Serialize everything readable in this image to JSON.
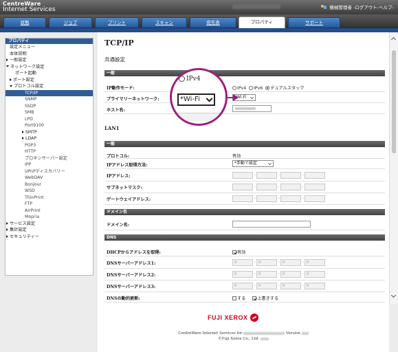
{
  "header": {
    "brand_line1": "CentreWare",
    "brand_line2": "Internet Services",
    "user_menu": "機械管理者 -ログアウト-ヘルプ-"
  },
  "tabs": [
    {
      "label": "状態"
    },
    {
      "label": "ジョブ"
    },
    {
      "label": "プリント"
    },
    {
      "label": "スキャン"
    },
    {
      "label": "宛先表"
    },
    {
      "label": "プロパティ"
    },
    {
      "label": "サポート"
    }
  ],
  "sidebar": {
    "heading": "プロパティ",
    "items": [
      {
        "label": "設定メニュー"
      },
      {
        "label": "本体説明"
      },
      {
        "label": "一般設定"
      },
      {
        "label": "ネットワーク設定"
      },
      {
        "label": "ポート起動"
      },
      {
        "label": "ポート設定"
      },
      {
        "label": "プロトコル設定"
      },
      {
        "label": "TCP/IP"
      },
      {
        "label": "SNMP"
      },
      {
        "label": "SSDP"
      },
      {
        "label": "SMB"
      },
      {
        "label": "LPD"
      },
      {
        "label": "Port9100"
      },
      {
        "label": "SMTP"
      },
      {
        "label": "LDAP"
      },
      {
        "label": "POP3"
      },
      {
        "label": "HTTP"
      },
      {
        "label": "プロキシサーバー設定"
      },
      {
        "label": "IPP"
      },
      {
        "label": "UPnPディスカバリー"
      },
      {
        "label": "WebDAV"
      },
      {
        "label": "Bonjour"
      },
      {
        "label": "WSD"
      },
      {
        "label": "ThinPrint"
      },
      {
        "label": "FTP"
      },
      {
        "label": "AirPrint"
      },
      {
        "label": "Mopria"
      },
      {
        "label": "サービス設定"
      },
      {
        "label": "集計設定"
      },
      {
        "label": "セキュリティー"
      }
    ]
  },
  "main": {
    "title": "TCP/IP",
    "common_heading": "共通設定",
    "general_bar": "一般",
    "ip_mode_label": "IP動作モード:",
    "ip_modes": [
      "IPv4",
      "IPv6",
      "デュアルスタック"
    ],
    "primary_network_label": "プライマリーネットワーク:",
    "primary_network_value": "*Wi-Fi",
    "hostname_label": "ホスト名:",
    "lan_heading": "LAN1",
    "lan_general_bar": "一般",
    "protocol_label": "プロトコル:",
    "protocol_value": "有効",
    "ip_acquire_label": "IPアドレス取得方法:",
    "ip_acquire_value": "*手動で設定",
    "ip_address_label": "IPアドレス:",
    "subnet_label": "サブネットマスク:",
    "gateway_label": "ゲートウェイアドレス:",
    "domain_bar": "ドメイン名",
    "domain_label": "ドメイン名:",
    "dns_bar": "DNS",
    "dhcp_dns_label": "DHCPからアドレスを取得:",
    "dhcp_dns_value": "有効",
    "dns1_label": "DNSサーバーアドレス1:",
    "dns2_label": "DNSサーバーアドレス2:",
    "dns3_label": "DNSサーバーアドレス3:",
    "dns_dynamic_label": "DNSの動的更新:",
    "dns_dynamic_opt1": "する",
    "dns_dynamic_opt2": "上書きする",
    "ip_octet_zero": "0"
  },
  "magnifier": {
    "ipv4_text": "IPv4",
    "select_text": "*Wi-Fi"
  },
  "footer": {
    "logo_text": "FUJI XEROX",
    "line1_prefix": "CentreWare Internet Services for",
    "line1_suffix": "Version",
    "line2": "©Fuji Xerox Co., Ltd."
  },
  "colors": {
    "accent_blue": "#2f5d98",
    "callout_magenta": "#9c1f7e",
    "logo_red": "#d0021b"
  }
}
